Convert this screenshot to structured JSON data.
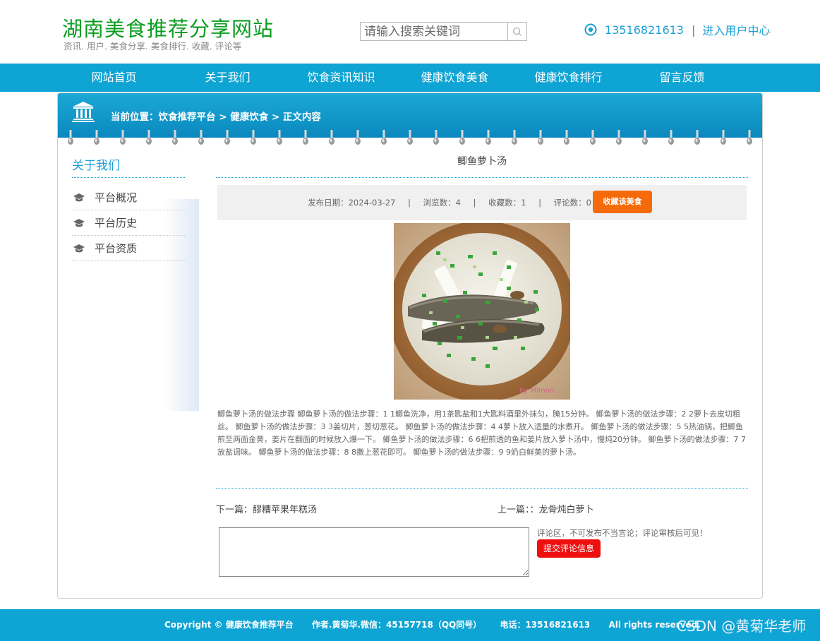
{
  "header": {
    "title": "湖南美食推荐分享网站",
    "subtitle": "资讯. 用户. 美食分享. 美食排行. 收藏. 评论等",
    "search_placeholder": "请输入搜索关键词",
    "phone": "13516821613",
    "separator": "|",
    "user_center": "进入用户中心"
  },
  "nav": {
    "items": [
      {
        "label": "网站首页"
      },
      {
        "label": "关于我们"
      },
      {
        "label": "饮食资讯知识"
      },
      {
        "label": "健康饮食美食"
      },
      {
        "label": "健康饮食排行"
      },
      {
        "label": "留言反馈"
      }
    ]
  },
  "breadcrumb": {
    "text": "当前位置：饮食推荐平台 > 健康饮食 > 正文内容"
  },
  "sidebar": {
    "title": "关于我们",
    "items": [
      {
        "label": "平台概况"
      },
      {
        "label": "平台历史"
      },
      {
        "label": "平台资质"
      }
    ]
  },
  "article": {
    "title": "鲫鱼萝卜汤",
    "publish_date": "发布日期：2024-03-27",
    "views": "浏览数：4",
    "favorites": "收藏数：1",
    "comments": "评论数：0",
    "meta_separator": "|",
    "favorite_button": "收藏该美食",
    "photo_watermark": "by Mimon",
    "body": "鲫鱼萝卜汤的做法步骤 鲫鱼萝卜汤的做法步骤：1 1鲫鱼洗净，用1茶匙盐和1大匙料酒里外抹匀，腌15分钟。 鲫鱼萝卜汤的做法步骤：2 2萝卜去皮切粗丝。 鲫鱼萝卜汤的做法步骤：3 3姜切片，葱切葱花。 鲫鱼萝卜汤的做法步骤：4 4萝卜放入适量的水煮开。 鲫鱼萝卜汤的做法步骤：5 5热油锅，把鲫鱼煎至两面金黄，姜片在翻面的时候放入爆一下。 鲫鱼萝卜汤的做法步骤：6 6把煎透的鱼和姜片放入萝卜汤中，慢炖20分钟。 鲫鱼萝卜汤的做法步骤：7 7放盐调味。 鲫鱼萝卜汤的做法步骤：8 8撒上葱花即可。 鲫鱼萝卜汤的做法步骤：9 9奶白鲜美的萝卜汤。",
    "next": "下一篇：醪糟苹果年糕汤",
    "prev": "上一篇：：龙骨炖白萝卜",
    "comment_note": "评论区，不可发布不当言论；评论审核后可见！",
    "submit_button": "提交评论信息"
  },
  "footer": {
    "copyright": "Copyright © 健康饮食推荐平台",
    "author": "作者.黄菊华.微信：45157718（QQ同号）",
    "phone": "电话：13516821613",
    "rights": "All rights reserved."
  },
  "watermark": "CSDN @黄菊华老师",
  "colors": {
    "title_green": "#0a9c1f",
    "accent_blue": "#0ea4d4",
    "favorite_orange": "#f56a0b",
    "submit_red": "#ee0f0f"
  },
  "icons": [
    "search-icon",
    "location-icon",
    "bank-building-icon",
    "ring-binder-icon",
    "graduation-cap-icon"
  ]
}
